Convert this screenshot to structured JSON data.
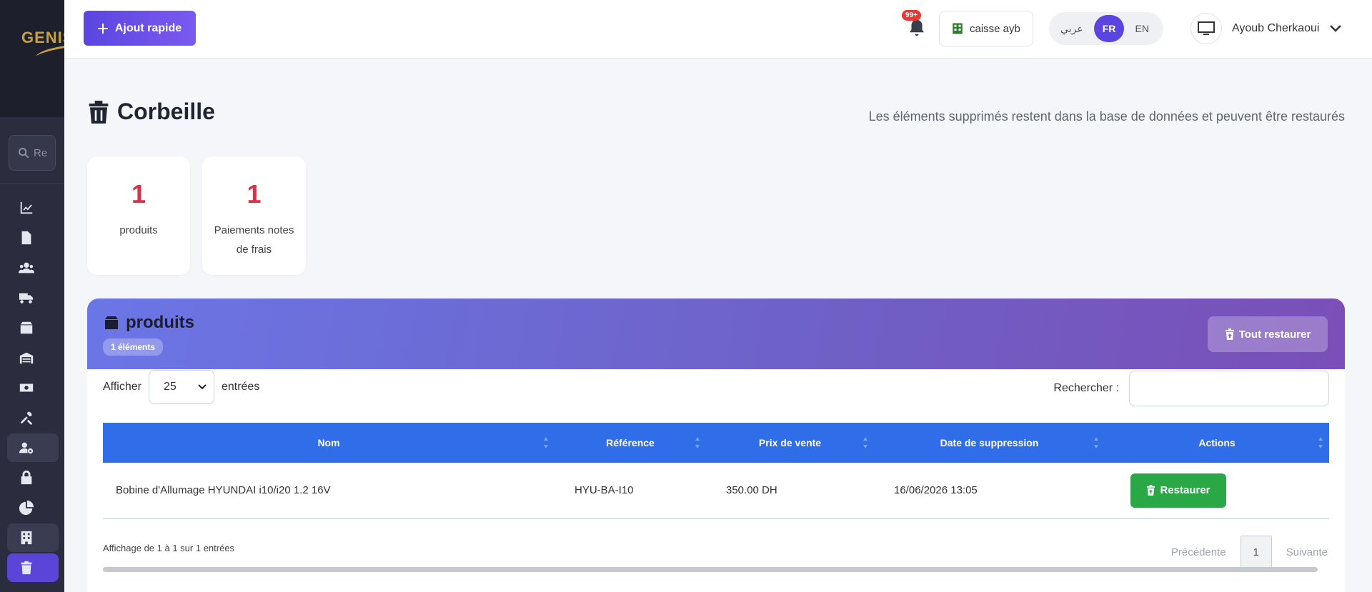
{
  "sidebar": {
    "logo": "GENIS",
    "search_placeholder": "Re",
    "nav_icons": [
      "chart-line-icon",
      "file-icon",
      "users-icon",
      "truck-icon",
      "box-icon",
      "warehouse-icon",
      "money-icon",
      "tools-icon",
      "user-gear-icon",
      "lock-icon",
      "pie-chart-icon",
      "building-icon",
      "trash-icon"
    ]
  },
  "topbar": {
    "quick_add_label": "Ajout rapide",
    "notif_badge": "99+",
    "store_name": "caisse ayb",
    "lang_ar": "عربي",
    "lang_fr": "FR",
    "lang_en": "EN",
    "user_name": "Ayoub Cherkaoui"
  },
  "page": {
    "title": "Corbeille",
    "subtitle": "Les éléments supprimés restent dans la base de données et peuvent être restaurés"
  },
  "stats": [
    {
      "count": "1",
      "label": "produits"
    },
    {
      "count": "1",
      "label": "Paiements notes de frais"
    }
  ],
  "panel": {
    "title": "produits",
    "badge": "1 éléments",
    "restore_all_label": "Tout restaurer",
    "show_label": "Afficher",
    "page_length": "25",
    "entries_label": "entrées",
    "search_label": "Rechercher :",
    "columns": [
      "Nom",
      "Référence",
      "Prix de vente",
      "Date de suppression",
      "Actions"
    ],
    "rows": [
      {
        "nom": "Bobine d'Allumage HYUNDAI i10/i20 1.2 16V",
        "reference": "HYU-BA-I10",
        "prix": "350.00 DH",
        "date": "16/06/2026 13:05",
        "action": "Restaurer"
      }
    ],
    "info": "Affichage de 1 à 1 sur 1 entrées",
    "prev_label": "Précédente",
    "current_page": "1",
    "next_label": "Suivante"
  },
  "colors": {
    "accent": "#5b45e0",
    "table_header": "#2f6ee8",
    "restore_green": "#2aa845",
    "stat_number": "#d63347"
  }
}
